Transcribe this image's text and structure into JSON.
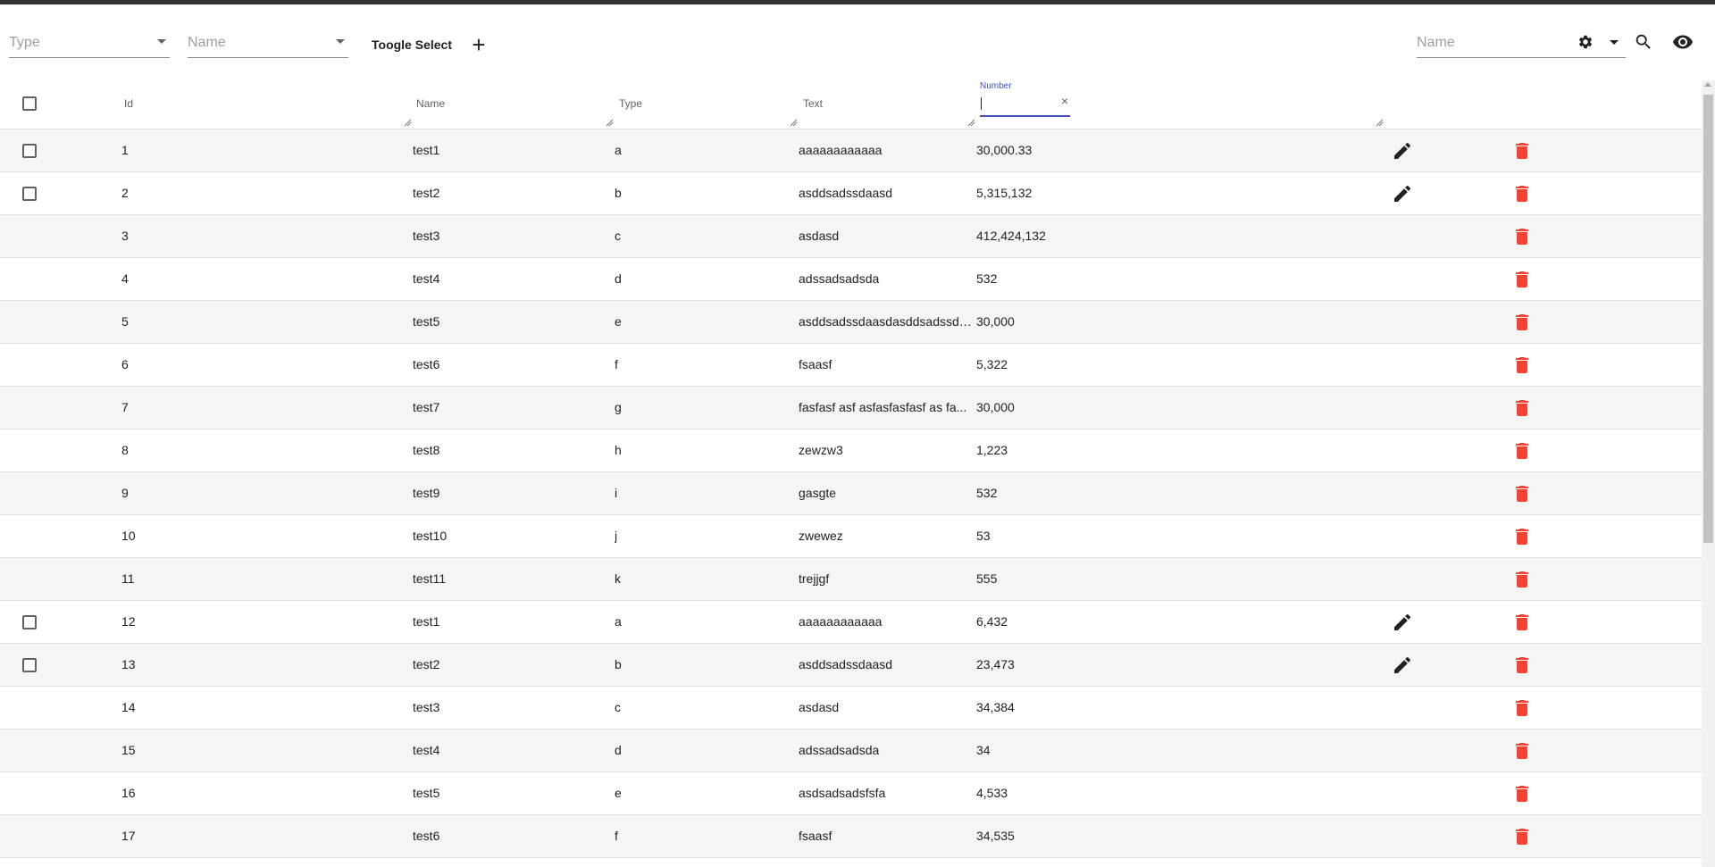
{
  "toolbar": {
    "type_placeholder": "Type",
    "name_placeholder": "Name",
    "toggle_select_label": "Toogle Select",
    "add_symbol": "+",
    "search_placeholder": "Name"
  },
  "table": {
    "columns": {
      "id": "Id",
      "name": "Name",
      "type": "Type",
      "text": "Text",
      "number_filter_label": "Number",
      "number_filter_clear": "×"
    },
    "rows": [
      {
        "id": "1",
        "name": "test1",
        "type": "a",
        "text": "aaaaaaaaaaaa",
        "number": "30,000.33",
        "selectable": true,
        "editable": true
      },
      {
        "id": "2",
        "name": "test2",
        "type": "b",
        "text": "asddsadssdaasd",
        "number": "5,315,132",
        "selectable": true,
        "editable": true
      },
      {
        "id": "3",
        "name": "test3",
        "type": "c",
        "text": "asdasd",
        "number": "412,424,132",
        "selectable": false,
        "editable": false
      },
      {
        "id": "4",
        "name": "test4",
        "type": "d",
        "text": "adssadsadsda",
        "number": "532",
        "selectable": false,
        "editable": false
      },
      {
        "id": "5",
        "name": "test5",
        "type": "e",
        "text": "asddsadssdaasdasddsadssda...",
        "number": "30,000",
        "selectable": false,
        "editable": false
      },
      {
        "id": "6",
        "name": "test6",
        "type": "f",
        "text": "fsaasf",
        "number": "5,322",
        "selectable": false,
        "editable": false
      },
      {
        "id": "7",
        "name": "test7",
        "type": "g",
        "text": "fasfasf asf asfasfasfasf as fa...",
        "number": "30,000",
        "selectable": false,
        "editable": false
      },
      {
        "id": "8",
        "name": "test8",
        "type": "h",
        "text": "zewzw3",
        "number": "1,223",
        "selectable": false,
        "editable": false
      },
      {
        "id": "9",
        "name": "test9",
        "type": "i",
        "text": "gasgte",
        "number": "532",
        "selectable": false,
        "editable": false
      },
      {
        "id": "10",
        "name": "test10",
        "type": "j",
        "text": "zwewez",
        "number": "53",
        "selectable": false,
        "editable": false
      },
      {
        "id": "11",
        "name": "test11",
        "type": "k",
        "text": "trejjgf",
        "number": "555",
        "selectable": false,
        "editable": false
      },
      {
        "id": "12",
        "name": "test1",
        "type": "a",
        "text": "aaaaaaaaaaaa",
        "number": "6,432",
        "selectable": true,
        "editable": true
      },
      {
        "id": "13",
        "name": "test2",
        "type": "b",
        "text": "asddsadssdaasd",
        "number": "23,473",
        "selectable": true,
        "editable": true
      },
      {
        "id": "14",
        "name": "test3",
        "type": "c",
        "text": "asdasd",
        "number": "34,384",
        "selectable": false,
        "editable": false
      },
      {
        "id": "15",
        "name": "test4",
        "type": "d",
        "text": "adssadsadsda",
        "number": "34",
        "selectable": false,
        "editable": false
      },
      {
        "id": "16",
        "name": "test5",
        "type": "e",
        "text": "asdsadsadsfsfa",
        "number": "4,533",
        "selectable": false,
        "editable": false
      },
      {
        "id": "17",
        "name": "test6",
        "type": "f",
        "text": "fsaasf",
        "number": "34,535",
        "selectable": false,
        "editable": false
      }
    ]
  },
  "colors": {
    "delete": "#f44336",
    "accent": "#3f51b5",
    "stripe": "#f5f5f5"
  },
  "icons": {
    "edit": "pencil-icon",
    "delete": "trash-icon",
    "search": "search-icon",
    "visibility": "eye-icon",
    "settings": "gear-icon"
  }
}
